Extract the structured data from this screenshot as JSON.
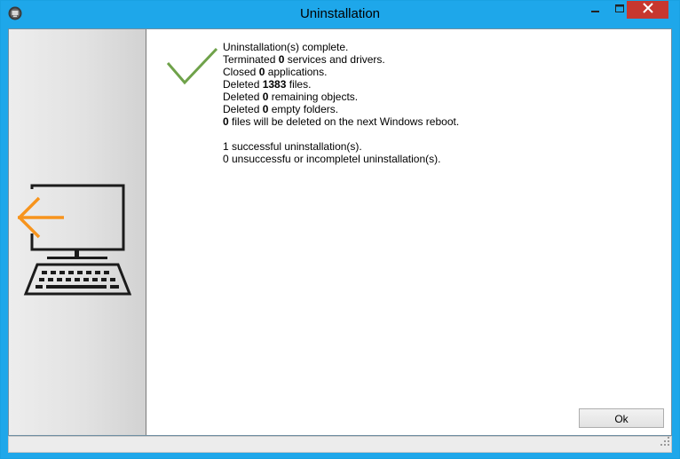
{
  "window": {
    "title": "Uninstallation",
    "accent_color": "#1ea7ea",
    "close_color": "#c7372f"
  },
  "icons": {
    "app": "app-icon",
    "minimize": "minimize-icon",
    "maximize": "maximize-icon",
    "close": "close-icon",
    "illustration": "computer-uninstall-icon",
    "success": "checkmark-icon",
    "grip": "resize-grip-icon"
  },
  "message": {
    "line1": "Uninstallation(s) complete.",
    "terminated_prefix": "Terminated ",
    "terminated_count": "0",
    "terminated_suffix": " services and drivers.",
    "closed_prefix": "Closed ",
    "closed_count": "0",
    "closed_suffix": " applications.",
    "deleted_files_prefix": "Deleted ",
    "deleted_files_count": "1383",
    "deleted_files_suffix": " files.",
    "remaining_prefix": "Deleted ",
    "remaining_count": "0",
    "remaining_suffix": " remaining objects.",
    "folders_prefix": "Deleted ",
    "folders_count": "0",
    "folders_suffix": " empty folders.",
    "reboot_count": "0",
    "reboot_suffix": " files will be deleted on the next Windows reboot.",
    "successful": "1 successful uninstallation(s).",
    "unsuccessful": "0 unsuccessfu or incompletel uninstallation(s)."
  },
  "buttons": {
    "ok_label": "Ok"
  }
}
